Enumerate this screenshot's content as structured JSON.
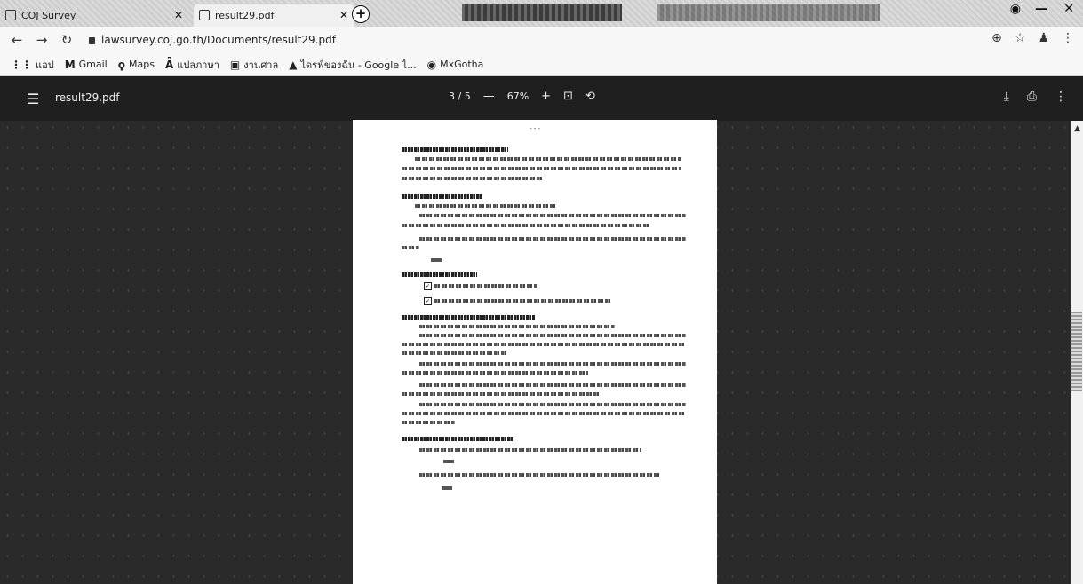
{
  "tabs": [
    {
      "title": "COJ Survey"
    },
    {
      "title": "result29.pdf"
    }
  ],
  "toolbar": {
    "back_icon": "back-arrow-icon",
    "forward_icon": "forward-arrow-icon",
    "reload_icon": "reload-icon",
    "url": "lawsurvey.coj.go.th/Documents/result29.pdf"
  },
  "bookmarks": [
    {
      "label": "แอป",
      "icon": "apps-grid-icon"
    },
    {
      "label": "Gmail",
      "icon": "gmail-icon"
    },
    {
      "label": "Maps",
      "icon": "maps-icon"
    },
    {
      "label": "แปลภาษา",
      "icon": "translate-icon"
    },
    {
      "label": "งานศาล",
      "icon": "folder-icon"
    },
    {
      "label": "ไดรฟ์ของฉัน - Google ไ...",
      "icon": "drive-icon"
    },
    {
      "label": "MxGotha",
      "icon": "globe-icon"
    }
  ],
  "pdf": {
    "filename": "result29.pdf",
    "page_indicator": "3 / 5",
    "zoom": "67%",
    "minus_label": "—",
    "plus_label": "+"
  }
}
